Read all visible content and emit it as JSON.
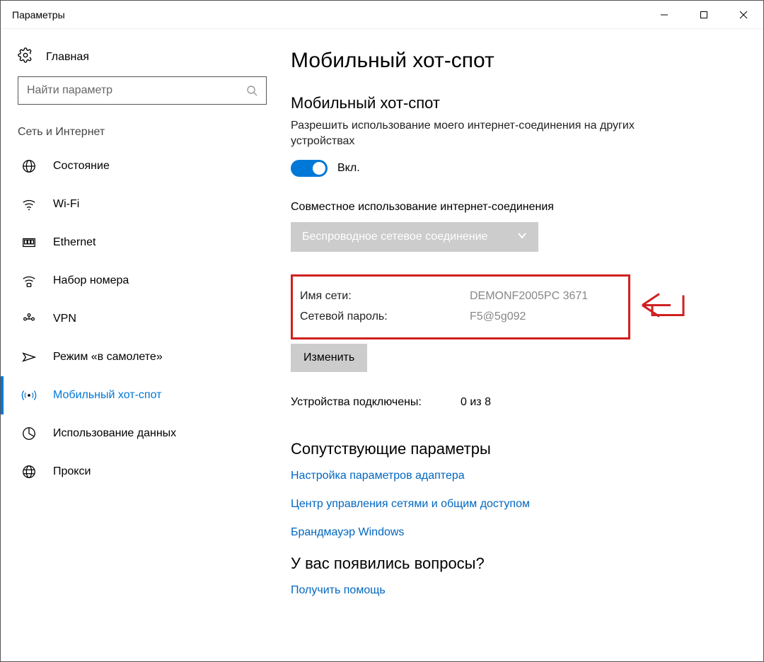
{
  "window": {
    "title": "Параметры"
  },
  "sidebar": {
    "home": "Главная",
    "search_placeholder": "Найти параметр",
    "heading": "Сеть и Интернет",
    "items": [
      {
        "label": "Состояние",
        "icon": "globe-dots-icon"
      },
      {
        "label": "Wi-Fi",
        "icon": "wifi-icon"
      },
      {
        "label": "Ethernet",
        "icon": "ethernet-icon"
      },
      {
        "label": "Набор номера",
        "icon": "dialup-icon"
      },
      {
        "label": "VPN",
        "icon": "vpn-icon"
      },
      {
        "label": "Режим «в самолете»",
        "icon": "airplane-icon"
      },
      {
        "label": "Мобильный хот-спот",
        "icon": "hotspot-icon",
        "active": true
      },
      {
        "label": "Использование данных",
        "icon": "data-usage-icon"
      },
      {
        "label": "Прокси",
        "icon": "proxy-icon"
      }
    ]
  },
  "main": {
    "title": "Мобильный хот-спот",
    "subtitle": "Мобильный хот-спот",
    "description": "Разрешить использование моего интернет-соединения на других устройствах",
    "toggle_label": "Вкл.",
    "share_label": "Совместное использование интернет-соединения",
    "dropdown_value": "Беспроводное сетевое соединение",
    "network_name_label": "Имя сети:",
    "network_name_value": "DEMONF2005PC 3671",
    "network_password_label": "Сетевой пароль:",
    "network_password_value": "F5@5g092",
    "change_button": "Изменить",
    "devices_label": "Устройства подключены:",
    "devices_value": "0 из 8",
    "related_title": "Сопутствующие параметры",
    "related_links": [
      "Настройка параметров адаптера",
      "Центр управления сетями и общим доступом",
      "Брандмауэр Windows"
    ],
    "help_title": "У вас появились вопросы?",
    "help_link": "Получить помощь"
  }
}
